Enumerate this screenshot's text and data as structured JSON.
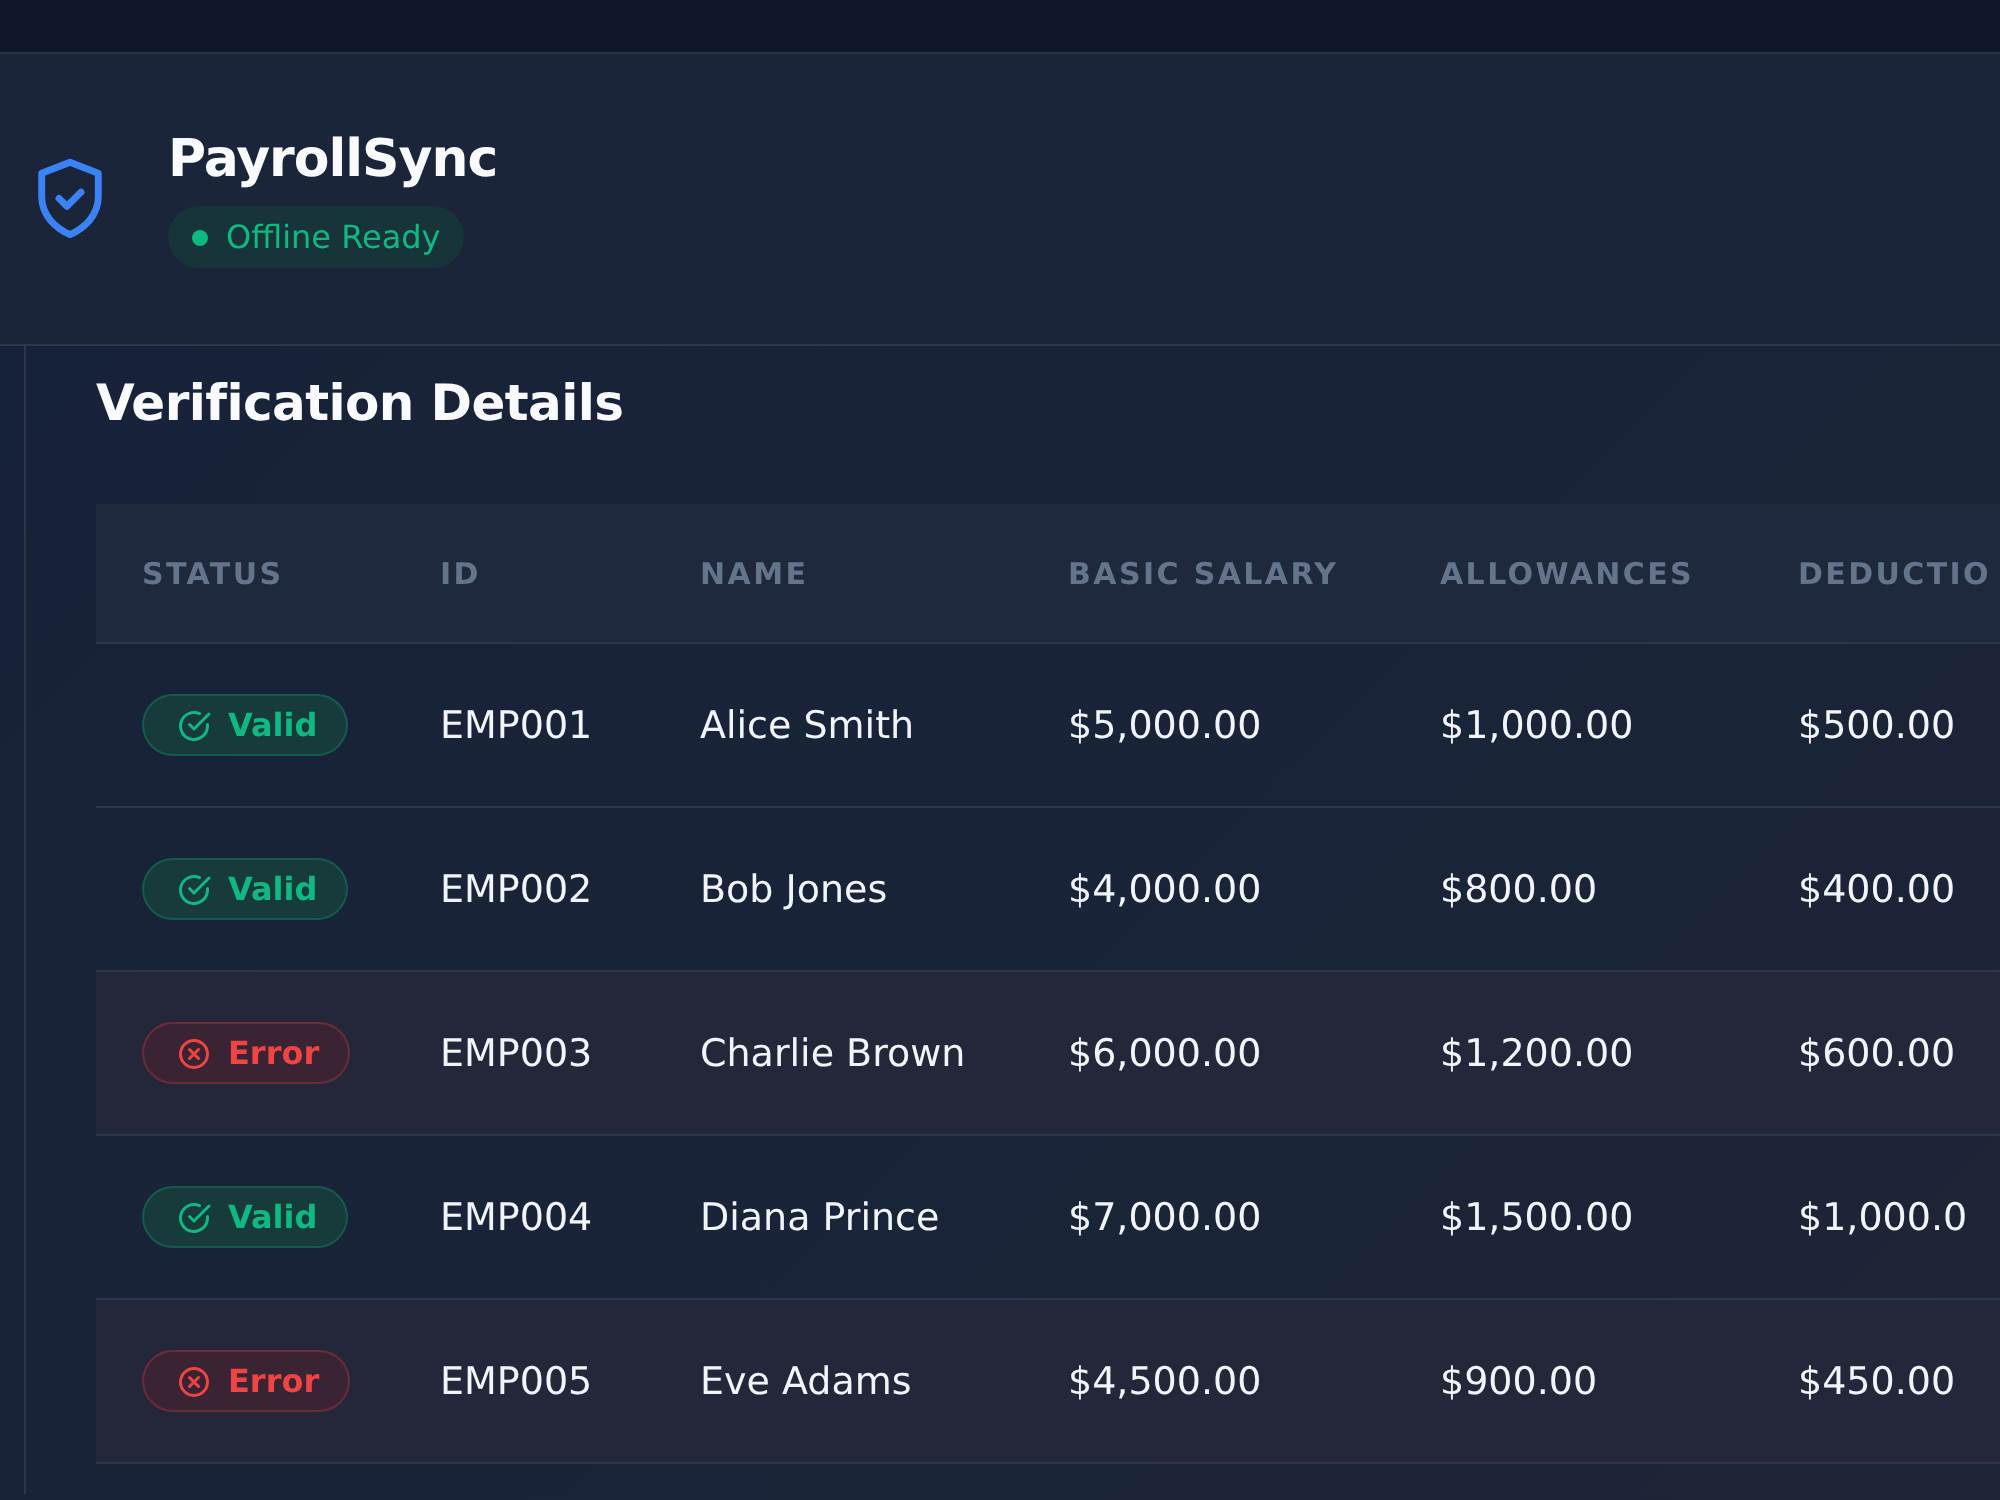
{
  "app": {
    "title": "PayrollSync",
    "badge": "Offline Ready"
  },
  "section": {
    "title": "Verification Details"
  },
  "table": {
    "columns": [
      "STATUS",
      "ID",
      "NAME",
      "BASIC SALARY",
      "ALLOWANCES",
      "DEDUCTIO"
    ],
    "rows": [
      {
        "cells": [
          {
            "kind": "valid",
            "text": "Valid"
          },
          {
            "kind": "text",
            "text": "EMP001"
          },
          {
            "kind": "text",
            "text": "Alice Smith"
          },
          {
            "kind": "text",
            "text": "$5,000.00"
          },
          {
            "kind": "text",
            "text": "$1,000.00"
          },
          {
            "kind": "text",
            "text": "$500.00"
          }
        ]
      },
      {
        "cells": [
          {
            "kind": "valid",
            "text": "Valid"
          },
          {
            "kind": "text",
            "text": "EMP002"
          },
          {
            "kind": "text",
            "text": "Bob Jones"
          },
          {
            "kind": "text",
            "text": "$4,000.00"
          },
          {
            "kind": "text",
            "text": "$800.00"
          },
          {
            "kind": "text",
            "text": "$400.00"
          }
        ]
      },
      {
        "cells": [
          {
            "kind": "error",
            "text": "Error"
          },
          {
            "kind": "text",
            "text": "EMP003"
          },
          {
            "kind": "text",
            "text": "Charlie Brown"
          },
          {
            "kind": "text",
            "text": "$6,000.00"
          },
          {
            "kind": "text",
            "text": "$1,200.00"
          },
          {
            "kind": "text",
            "text": "$600.00"
          }
        ]
      },
      {
        "cells": [
          {
            "kind": "valid",
            "text": "Valid"
          },
          {
            "kind": "text",
            "text": "EMP004"
          },
          {
            "kind": "text",
            "text": "Diana Prince"
          },
          {
            "kind": "text",
            "text": "$7,000.00"
          },
          {
            "kind": "text",
            "text": "$1,500.00"
          },
          {
            "kind": "text",
            "text": "$1,000.0"
          }
        ]
      },
      {
        "cells": [
          {
            "kind": "error",
            "text": "Error"
          },
          {
            "kind": "text",
            "text": "EMP005"
          },
          {
            "kind": "text",
            "text": "Eve Adams"
          },
          {
            "kind": "text",
            "text": "$4,500.00"
          },
          {
            "kind": "text",
            "text": "$900.00"
          },
          {
            "kind": "text",
            "text": "$450.00"
          }
        ]
      }
    ]
  }
}
